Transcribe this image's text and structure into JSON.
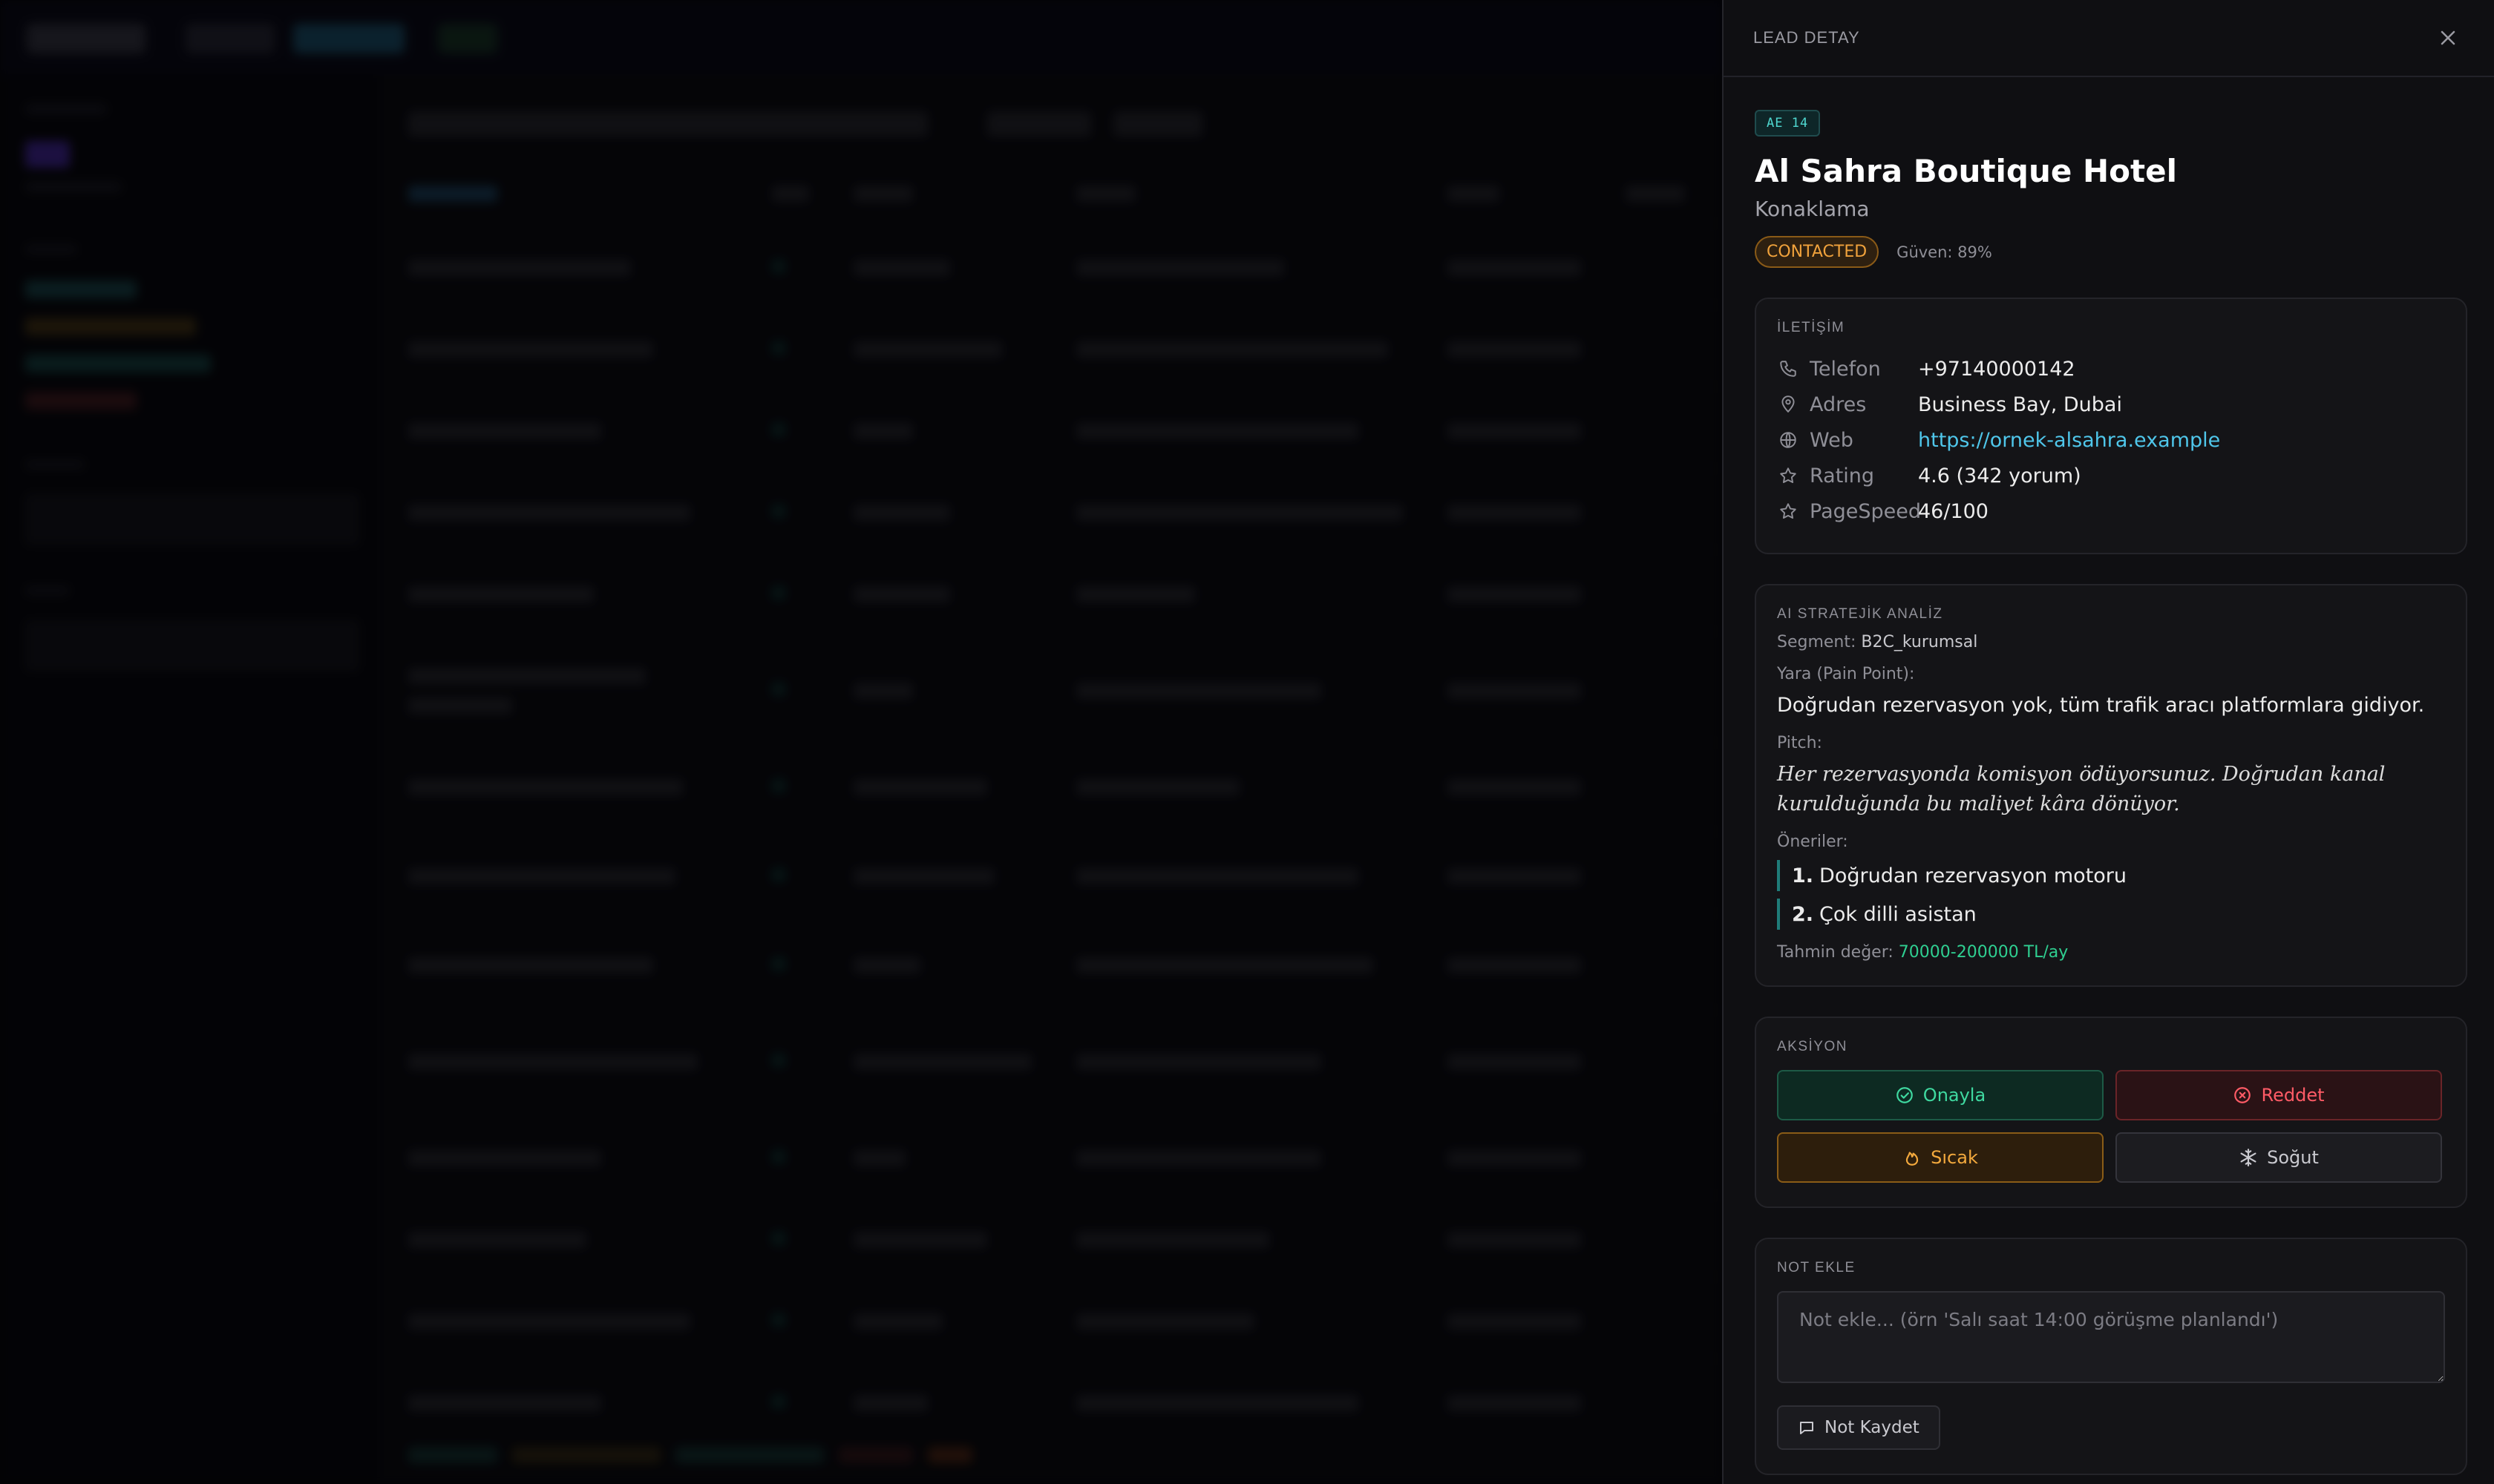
{
  "drawer": {
    "title": "LEAD DETAY",
    "lead_id": "AE 14",
    "name": "Al Sahra Boutique Hotel",
    "category": "Konaklama",
    "status": "CONTACTED",
    "confidence": "Güven: 89%"
  },
  "contact": {
    "label": "İLETİŞİM",
    "rows": [
      {
        "icon": "phone-icon",
        "label": "Telefon",
        "value": "+97140000142"
      },
      {
        "icon": "location-pin-icon",
        "label": "Adres",
        "value": "Business Bay, Dubai"
      },
      {
        "icon": "globe-icon",
        "label": "Web",
        "value": "https://ornek-alsahra.example"
      },
      {
        "icon": "star-icon",
        "label": "Rating",
        "value": "4.6 (342 yorum)"
      },
      {
        "icon": "star-icon",
        "label": "PageSpeed",
        "value": "46/100"
      }
    ]
  },
  "ai": {
    "label": "AI STRATEJİK ANALİZ",
    "segment_label": "Segment:",
    "segment_value": "B2C_kurumsal",
    "pain_label": "Yara (Pain Point):",
    "pain_text": "Doğrudan rezervasyon yok, tüm trafik aracı platformlara gidiyor.",
    "pitch_label": "Pitch:",
    "pitch_text": "Her rezervasyonda komisyon ödüyorsunuz. Doğrudan kanal kurulduğunda bu maliyet kâra dönüyor.",
    "rec_label": "Öneriler:",
    "recommendations": [
      {
        "num": "1.",
        "text": "Doğrudan rezervasyon motoru"
      },
      {
        "num": "2.",
        "text": "Çok dilli asistan"
      }
    ],
    "estimate_label": "Tahmin değer:",
    "estimate_value": "70000-200000 TL/ay"
  },
  "actions": {
    "label": "AKSİYON",
    "approve": "Onayla",
    "reject": "Reddet",
    "hot": "Sıcak",
    "cold": "Soğut"
  },
  "note": {
    "label": "NOT EKLE",
    "placeholder": "Not ekle... (örn 'Salı saat 14:00 görüşme planlandı')",
    "save": "Not Kaydet"
  },
  "colors": {
    "accent_teal": "#4fd8d0",
    "status_orange": "#f0a23c",
    "approve_green": "#3fd9a0",
    "reject_red": "#ff5b66",
    "link_blue": "#4fc6ea",
    "estimate_green": "#2fcf91"
  }
}
